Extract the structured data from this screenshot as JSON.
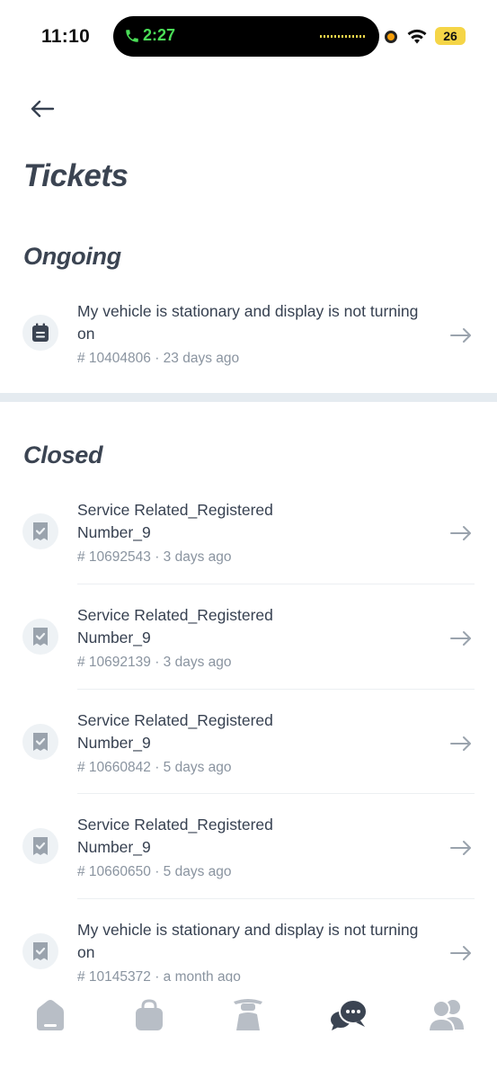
{
  "status_bar": {
    "time": "11:10",
    "call_timer": "2:27",
    "battery": "26"
  },
  "header": {
    "back_icon": "arrow-left-icon",
    "title": "Tickets"
  },
  "sections": {
    "ongoing": {
      "heading": "Ongoing",
      "tickets": [
        {
          "icon": "calendar-icon",
          "title": "My vehicle is stationary and display is not turning on",
          "meta": "# 10404806 · 23 days ago"
        }
      ]
    },
    "closed": {
      "heading": "Closed",
      "tickets": [
        {
          "icon": "receipt-check-icon",
          "title": "Service Related_Registered Number_9",
          "meta": "# 10692543 · 3 days ago"
        },
        {
          "icon": "receipt-check-icon",
          "title": "Service Related_Registered Number_9",
          "meta": "# 10692139 · 3 days ago"
        },
        {
          "icon": "receipt-check-icon",
          "title": "Service Related_Registered Number_9",
          "meta": "# 10660842 · 5 days ago"
        },
        {
          "icon": "receipt-check-icon",
          "title": "Service Related_Registered Number_9",
          "meta": "# 10660650 · 5 days ago"
        },
        {
          "icon": "receipt-check-icon",
          "title": "My vehicle is stationary and display is not turning on",
          "meta": "# 10145372 · a month ago"
        }
      ]
    }
  },
  "bottom_nav": {
    "items": [
      "home-icon",
      "bag-icon",
      "rider-icon",
      "chat-icon",
      "profile-icon"
    ],
    "active": "chat-icon"
  },
  "colors": {
    "text_primary": "#374151",
    "text_muted": "#8a94a0",
    "icon_bg": "#eef2f5",
    "icon_fg": "#9aa3ad",
    "nav_inactive": "#b8bec6",
    "nav_active": "#3b4452",
    "call_green": "#4ade57"
  }
}
